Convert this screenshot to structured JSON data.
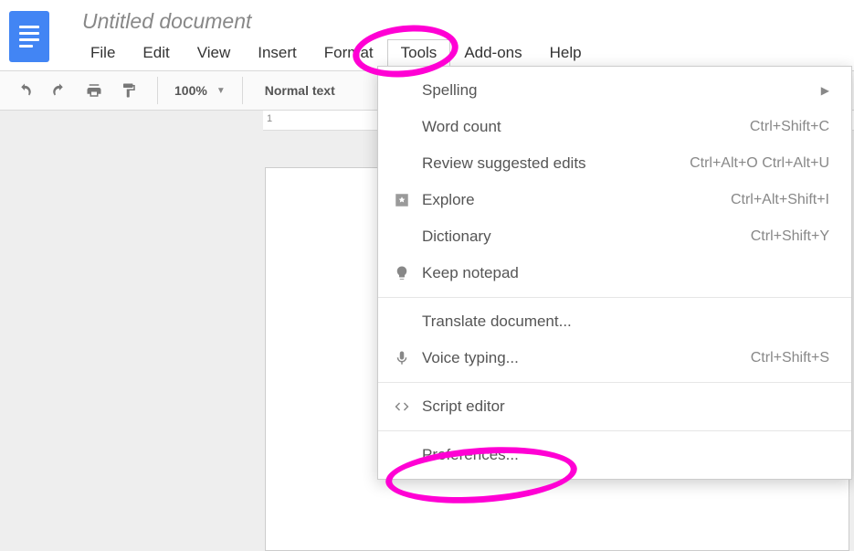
{
  "doc_title": "Untitled document",
  "menus": {
    "file": "File",
    "edit": "Edit",
    "view": "View",
    "insert": "Insert",
    "format": "Format",
    "tools": "Tools",
    "addons": "Add-ons",
    "help": "Help"
  },
  "toolbar": {
    "zoom": "100%",
    "style": "Normal text"
  },
  "ruler": {
    "mark": "1"
  },
  "tools_menu": {
    "spelling": {
      "label": "Spelling"
    },
    "word_count": {
      "label": "Word count",
      "shortcut": "Ctrl+Shift+C"
    },
    "review": {
      "label": "Review suggested edits",
      "shortcut": "Ctrl+Alt+O Ctrl+Alt+U"
    },
    "explore": {
      "label": "Explore",
      "shortcut": "Ctrl+Alt+Shift+I"
    },
    "dictionary": {
      "label": "Dictionary",
      "shortcut": "Ctrl+Shift+Y"
    },
    "keep": {
      "label": "Keep notepad"
    },
    "translate": {
      "label": "Translate document..."
    },
    "voice": {
      "label": "Voice typing...",
      "shortcut": "Ctrl+Shift+S"
    },
    "script": {
      "label": "Script editor"
    },
    "prefs": {
      "label": "Preferences..."
    }
  }
}
